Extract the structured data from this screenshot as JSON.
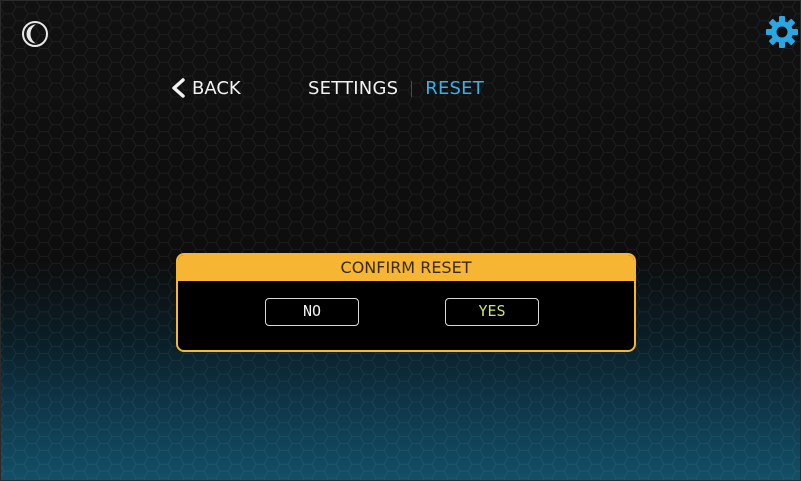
{
  "nav": {
    "back_label": "BACK",
    "breadcrumb": {
      "parent": "SETTINGS",
      "current": "RESET"
    }
  },
  "icons": {
    "theme_toggle": "moon-icon",
    "settings": "gear-icon",
    "back": "chevron-left-icon"
  },
  "dialog": {
    "title": "CONFIRM RESET",
    "no_label": "NO",
    "yes_label": "YES"
  },
  "colors": {
    "accent_blue": "#38b1e6",
    "dialog_accent": "#f6b533",
    "yes_text": "#cfe06a"
  }
}
